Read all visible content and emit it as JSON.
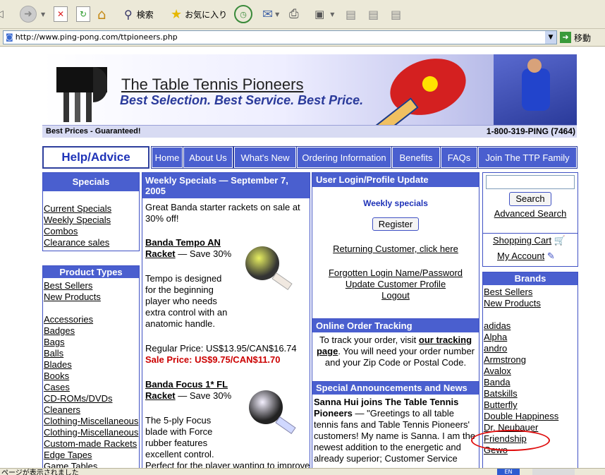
{
  "browser": {
    "toolbar": {
      "search_label": "検索",
      "favorites_label": "お気に入り"
    },
    "address": {
      "url": "http://www.ping-pong.com/ttpioneers.php",
      "go_label": "移動"
    }
  },
  "site": {
    "title": "The Table Tennis Pioneers",
    "tagline": "Best Selection. Best Service. Best Price.",
    "strip_left": "Best Prices - Guaranteed!",
    "phone": "1-800-319-PING (7464)",
    "help_button": "Help/Advice",
    "nav": [
      "Home",
      "About Us",
      "What's New",
      "Ordering Information",
      "Benefits",
      "FAQs",
      "Join The TTP Family"
    ]
  },
  "specials": {
    "title": "Specials",
    "links": [
      "Current Specials",
      "Weekly Specials",
      "Combos",
      "Clearance sales"
    ]
  },
  "product_types": {
    "title": "Product Types",
    "top_links": [
      "Best Sellers",
      "New Products"
    ],
    "links": [
      "Accessories",
      "Badges",
      "Bags",
      "Balls",
      "Blades",
      "Books",
      "Cases",
      "CD-ROMs/DVDs",
      "Cleaners",
      "Clothing-Miscellaneous",
      "Clothing-Miscellaneous",
      "Custom-made Rackets",
      "Edge Tapes",
      "Game Tables"
    ]
  },
  "weekly": {
    "title": "Weekly Specials — September 7, 2005",
    "intro": "Great Banda starter rackets on sale at 30% off!",
    "item1_name": "Banda Tempo AN Racket",
    "item1_save": "— Save 30%",
    "item1_desc": "Tempo is designed for the beginning player who needs extra control with an anatomic handle.",
    "item1_regular": "Regular Price: US$13.95/CAN$16.74",
    "item1_sale": "Sale Price: US$9.75/CAN$11.70",
    "item2_name": "Banda Focus 1* FL Racket",
    "item2_save": "— Save 30%",
    "item2_desc": "The 5-ply Focus blade with Force rubber features excellent control.",
    "item2_more": "Perfect for the player wanting to improve"
  },
  "login": {
    "title": "User Login/Profile Update",
    "weekly": "Weekly specials",
    "register": "Register",
    "returning": "Returning Customer, click here",
    "forgot": "Forgotten Login Name/Password",
    "update": "Update Customer Profile",
    "logout": "Logout"
  },
  "tracking": {
    "title": "Online Order Tracking",
    "text1": "To track your order, visit",
    "link": "our tracking page",
    "text2": "You will need your order number and your Zip Code or Postal Code."
  },
  "announce": {
    "title": "Special Announcements and News",
    "headline": "Sanna Hui joins The Table Tennis Pioneers",
    "body": "— \"Greetings to all table tennis fans and Table Tennis Pioneers' customers! My name is Sanna. I am the newest addition to the energetic and already superior; Customer Service"
  },
  "search": {
    "button": "Search",
    "advanced": "Advanced Search",
    "cart": "Shopping Cart",
    "account": "My Account"
  },
  "brands": {
    "title": "Brands",
    "top_links": [
      "Best Sellers",
      "New Products"
    ],
    "links": [
      "adidas",
      "Alpha",
      "andro",
      "Armstrong",
      "Avalox",
      "Banda",
      "Batskills",
      "Butterfly",
      "Double Happiness",
      "Dr. Neubauer",
      "Friendship",
      "Gewo"
    ],
    "highlighted": "Dr. Neubauer"
  },
  "status": {
    "left": "ページが表示されました",
    "lang": "EN"
  },
  "colors": {
    "header_blue": "#4a5fcf",
    "annotation_red": "#e01010",
    "sale_red": "#cc0000"
  }
}
